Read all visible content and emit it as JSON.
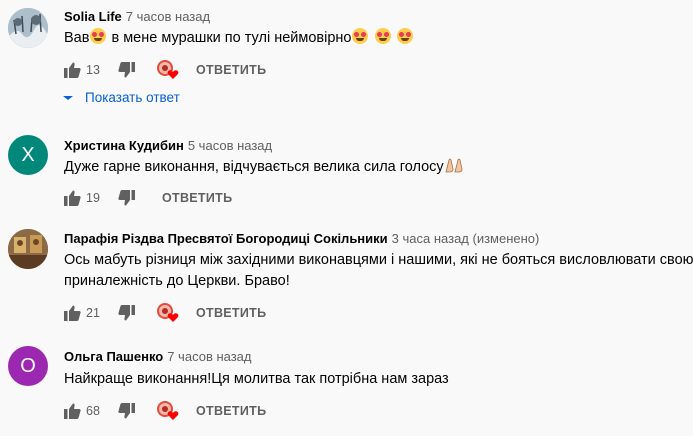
{
  "comments": [
    {
      "author": "Solia Life",
      "time": "7 часов назад",
      "text_parts": [
        "Вав",
        " в мене мурашки по тулі неймовірно"
      ],
      "likes": "13",
      "reply_label": "ОТВЕТИТЬ",
      "show_replies": "Показать ответ",
      "avatar_color": "#8aa4b8"
    },
    {
      "author": "Христина Кудибин",
      "time": "5 часов назад",
      "text": "Дуже гарне виконання, відчувається велика сила голосу",
      "likes": "19",
      "reply_label": "ОТВЕТИТЬ",
      "avatar_letter": "Х",
      "avatar_color": "#00897b"
    },
    {
      "author": "Парафія Різдва Пресвятої Богородиці Сокільники",
      "time": "3 часа назад (изменено)",
      "text": "Ось мабуть різниця між західними виконавцями і нашими, які не бояться висловлювати свою приналежність до Церкви. Браво!",
      "likes": "21",
      "reply_label": "ОТВЕТИТЬ",
      "avatar_color": "#7a5a3a"
    },
    {
      "author": "Ольга Пашенко",
      "time": "7 часов назад",
      "text": "Найкраще виконання!Ця молитва так потрібна нам зараз",
      "likes": "68",
      "reply_label": "ОТВЕТИТЬ",
      "avatar_letter": "О",
      "avatar_color": "#9c27b0"
    }
  ],
  "icons": [
    "thumb-up-icon",
    "thumb-down-icon",
    "creator-heart-icon",
    "chevron-down-icon",
    "star-struck-emoji",
    "folded-hands-emoji"
  ],
  "colors": {
    "link": "#065fd4",
    "heart": "#ff0000",
    "secondary_text": "#606060"
  }
}
